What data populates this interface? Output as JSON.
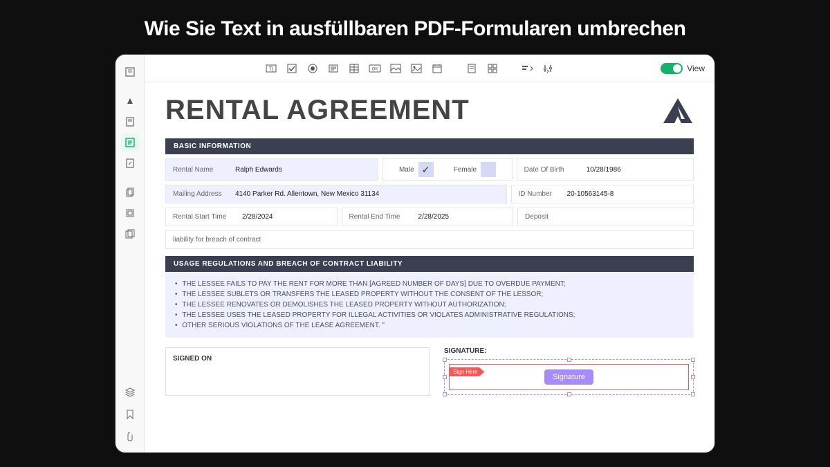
{
  "page_heading": "Wie Sie Text in ausfüllbaren PDF-Formularen umbrechen",
  "toolbar": {
    "view_label": "View"
  },
  "document": {
    "title": "RENTAL AGREEMENT",
    "sections": {
      "basic_info_header": "BASIC INFORMATION",
      "usage_header": "USAGE REGULATIONS AND BREACH OF CONTRACT LIABILITY"
    },
    "fields": {
      "rental_name_label": "Rental Name",
      "rental_name_value": "Ralph Edwards",
      "male_label": "Male",
      "female_label": "Female",
      "dob_label": "Date Of Birth",
      "dob_value": "10/28/1986",
      "mailing_label": "Mailing Address",
      "mailing_value": "4140 Parker Rd. Allentown, New Mexico 31134",
      "id_label": "ID Number",
      "id_value": "20-10563145-8",
      "start_label": "Rental Start Time",
      "start_value": "2/28/2024",
      "end_label": "Rental End Time",
      "end_value": "2/28/2025",
      "deposit_label": "Deposit",
      "liability_text": "liability for breach of contract"
    },
    "regulations": [
      "THE LESSEE FAILS TO PAY THE RENT FOR MORE THAN [AGREED NUMBER OF DAYS] DUE TO OVERDUE PAYMENT;",
      "THE LESSEE SUBLETS OR TRANSFERS THE LEASED PROPERTY WITHOUT THE CONSENT OF THE LESSOR;",
      "THE LESSEE RENOVATES OR DEMOLISHES THE LEASED PROPERTY WITHOUT AUTHORIZATION;",
      "THE LESSEE USES THE LEASED PROPERTY FOR ILLEGAL ACTIVITIES OR VIOLATES ADMINISTRATIVE REGULATIONS;",
      "OTHER SERIOUS VIOLATIONS OF THE LEASE AGREEMENT. \""
    ],
    "signed_on_label": "SIGNED ON",
    "signature_label": "SIGNATURE:",
    "sign_here": "Sign Here",
    "signature_button": "Signature"
  }
}
